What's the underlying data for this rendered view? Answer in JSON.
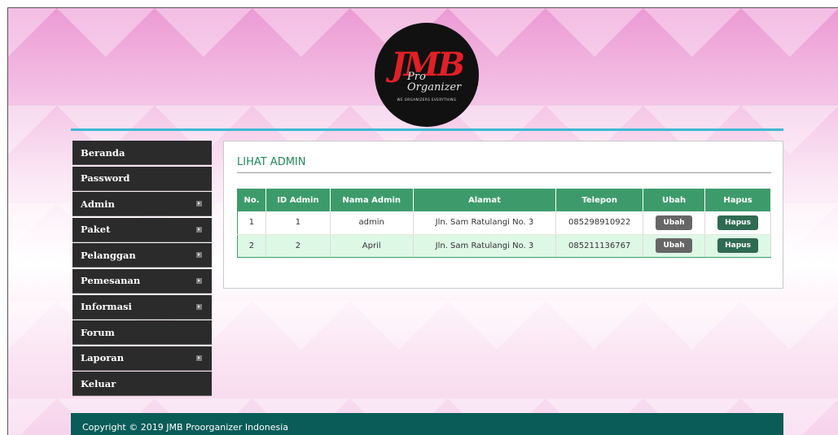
{
  "logo": {
    "main": "JMB",
    "sub": "Pro Organizer",
    "tagline": "WE ORGANIZERS EVERYTHING"
  },
  "sidebar": {
    "items": [
      {
        "label": "Beranda",
        "has_submenu": false
      },
      {
        "label": "Password",
        "has_submenu": false
      },
      {
        "label": "Admin",
        "has_submenu": true
      },
      {
        "label": "Paket",
        "has_submenu": true
      },
      {
        "label": "Pelanggan",
        "has_submenu": true
      },
      {
        "label": "Pemesanan",
        "has_submenu": true
      },
      {
        "label": "Informasi",
        "has_submenu": true
      },
      {
        "label": "Forum",
        "has_submenu": false
      },
      {
        "label": "Laporan",
        "has_submenu": true
      },
      {
        "label": "Keluar",
        "has_submenu": false
      }
    ]
  },
  "main": {
    "title": "LIHAT ADMIN",
    "table": {
      "headers": [
        "No.",
        "ID Admin",
        "Nama Admin",
        "Alamat",
        "Telepon",
        "Ubah",
        "Hapus"
      ],
      "rows": [
        {
          "no": "1",
          "id": "1",
          "nama": "admin",
          "alamat": "Jln. Sam Ratulangi No. 3",
          "telepon": "085298910922",
          "ubah": "Ubah",
          "hapus": "Hapus"
        },
        {
          "no": "2",
          "id": "2",
          "nama": "April",
          "alamat": "Jln. Sam Ratulangi No. 3",
          "telepon": "085211136767",
          "ubah": "Ubah",
          "hapus": "Hapus"
        }
      ]
    }
  },
  "footer": {
    "text": "Copyright © 2019 JMB Proorganizer Indonesia"
  },
  "colors": {
    "accent": "#3fb8d4",
    "table_header": "#3d9b6b",
    "footer": "#0a5c58",
    "sidebar": "#2b2b2b"
  }
}
